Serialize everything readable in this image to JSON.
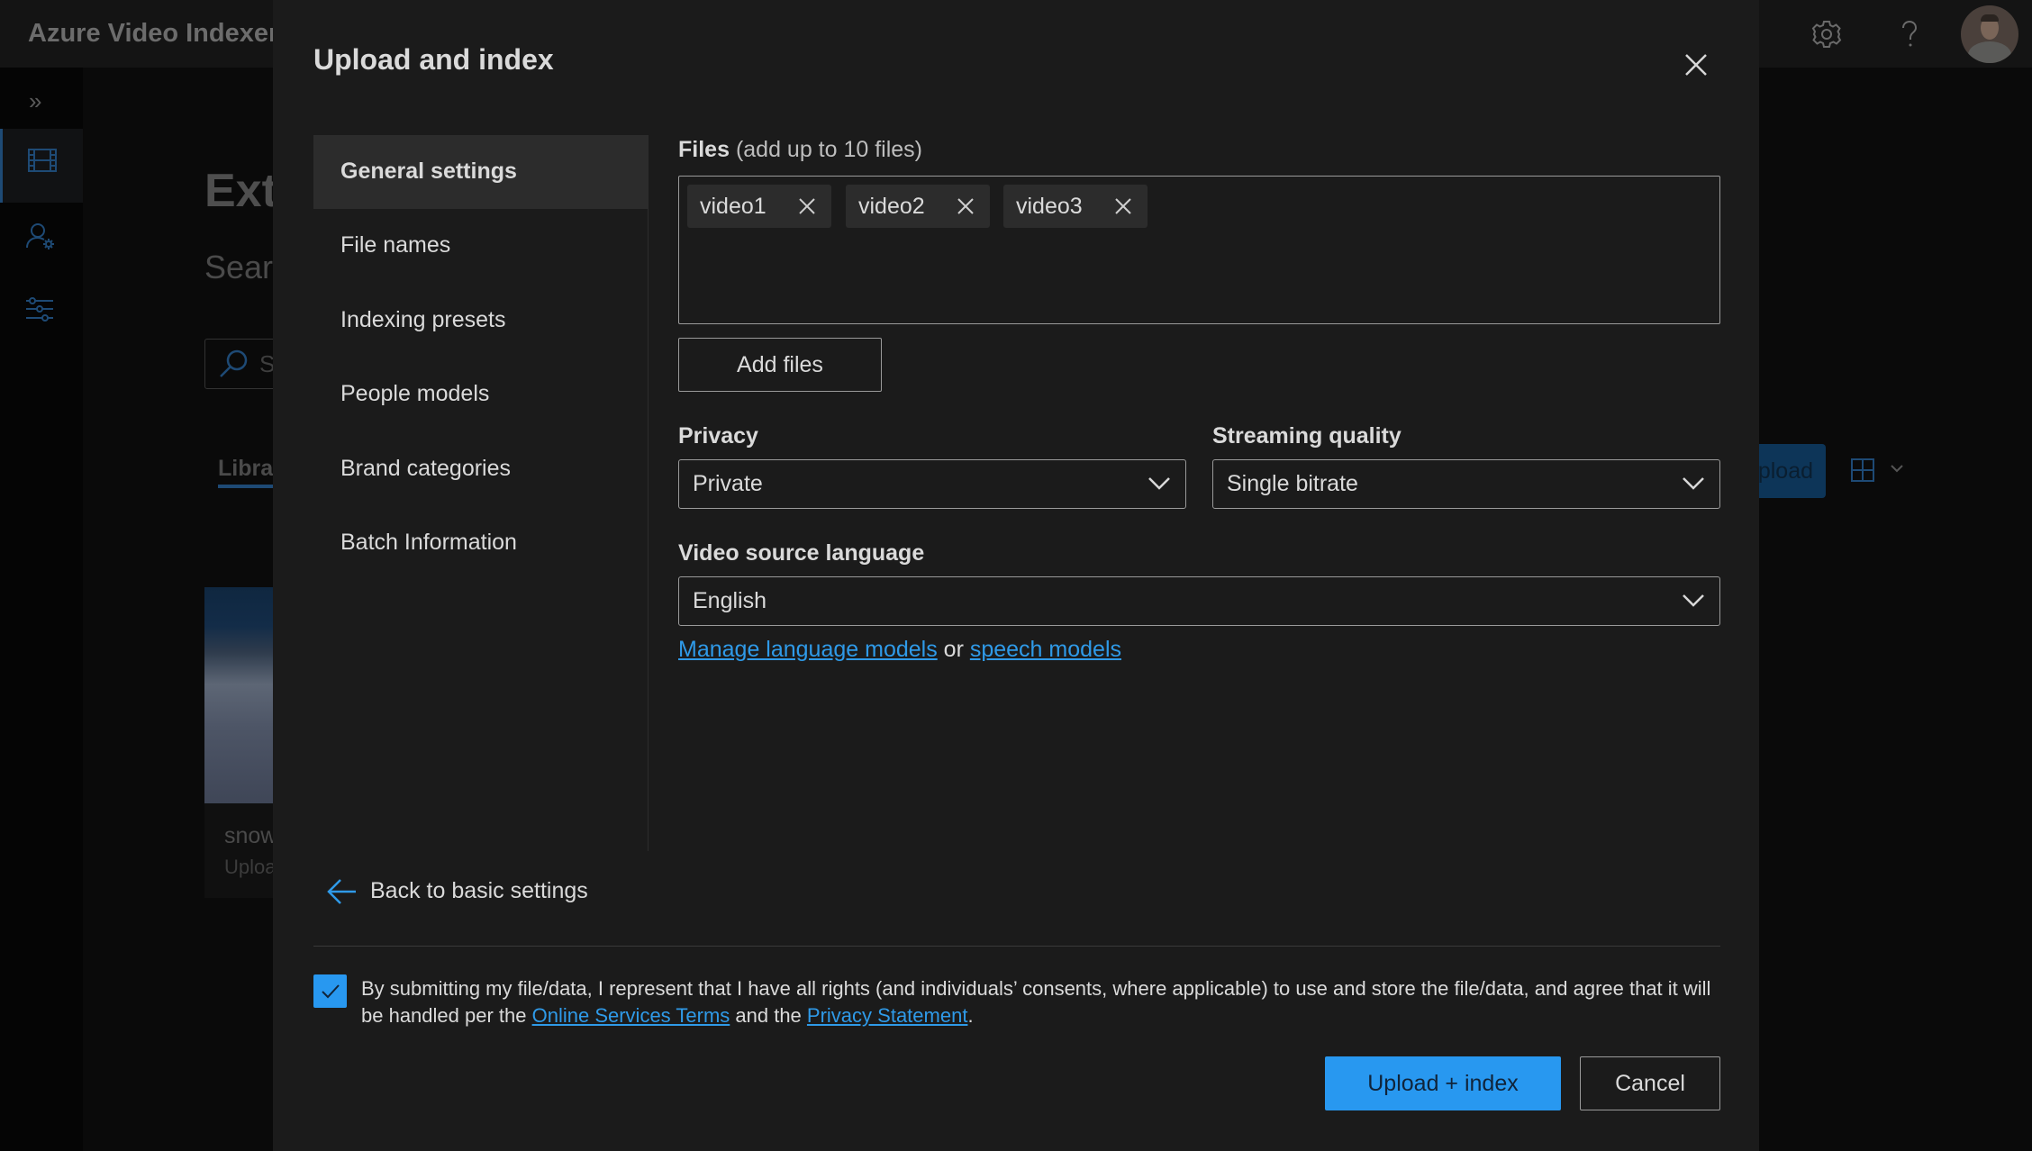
{
  "app": {
    "title": "Azure Video Indexer",
    "topbar_icons": [
      "gear-icon",
      "help-icon",
      "avatar"
    ]
  },
  "background": {
    "nav_items": [
      "film-icon",
      "person-settings-icon",
      "sliders-icon"
    ],
    "heading": "Ext",
    "subheading": "Searc",
    "search_placeholder": "S",
    "tab_label": "Librar",
    "card_title": "snow",
    "card_subtitle": "Uploa",
    "upload_button": "pload"
  },
  "modal": {
    "title": "Upload and index",
    "side_menu": [
      {
        "label": "General settings",
        "active": true
      },
      {
        "label": "File names",
        "active": false
      },
      {
        "label": "Indexing presets",
        "active": false
      },
      {
        "label": "People models",
        "active": false
      },
      {
        "label": "Brand categories",
        "active": false
      },
      {
        "label": "Batch Information",
        "active": false
      }
    ],
    "files": {
      "label": "Files",
      "hint": "(add up to 10 files)",
      "items": [
        "video1",
        "video2",
        "video3"
      ],
      "add_button": "Add files"
    },
    "privacy": {
      "label": "Privacy",
      "value": "Private"
    },
    "streaming_quality": {
      "label": "Streaming quality",
      "value": "Single bitrate"
    },
    "video_source_language": {
      "label": "Video source language",
      "value": "English"
    },
    "model_links": {
      "manage_language_models": "Manage language models",
      "or": " or ",
      "speech_models": "speech models"
    },
    "back_link": "Back to basic settings",
    "consent": {
      "checked": true,
      "text_before": "By submitting my file/data, I represent that I have all rights (and individuals’ consents, where applicable) to use and store the file/data, and agree that it will be handled per the ",
      "online_services_terms": "Online Services Terms",
      "and_the": " and the ",
      "privacy_statement": "Privacy Statement",
      "period": "."
    },
    "primary_button": "Upload + index",
    "cancel_button": "Cancel"
  },
  "colors": {
    "accent": "#2898f0",
    "link": "#2f9ae8",
    "modal_bg": "#1b1b1b",
    "active_menu_bg": "#2c2c2c"
  }
}
